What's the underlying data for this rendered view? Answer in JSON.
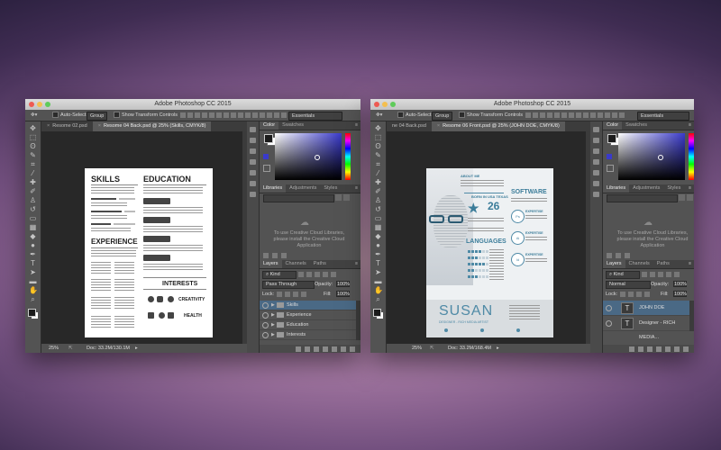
{
  "left": {
    "title": "Adobe Photoshop CC 2015",
    "options": {
      "auto_select": "Auto-Select:",
      "group": "Group",
      "transform": "Show Transform Controls",
      "workspace": "Essentials"
    },
    "tabs": [
      {
        "label": "Resome 02.psd",
        "active": false
      },
      {
        "label": "Resome 04 Back.psd @ 25% (Skills, CMYK/8)",
        "active": true
      }
    ],
    "status": {
      "zoom": "25%",
      "doc": "Doc: 33.2M/130.1M"
    },
    "resume": {
      "skills": "SKILLS",
      "education": "EDUCATION",
      "experience": "EXPERIENCE",
      "interests": "INTERESTS",
      "creativity": "CREATIVITY",
      "health": "HEALTH"
    },
    "color_tabs": [
      "Color",
      "Swatches"
    ],
    "libraries_tabs": [
      "Libraries",
      "Adjustments",
      "Styles"
    ],
    "libraries_msg": "To use Creative Cloud Libraries, please install the Creative Cloud Application",
    "layers_tabs": [
      "Layers",
      "Channels",
      "Paths"
    ],
    "kind": "Kind",
    "blend": "Pass Through",
    "opacity_label": "Opacity:",
    "opacity": "100%",
    "lock_label": "Lock:",
    "fill_label": "Fill:",
    "fill": "100%",
    "layers": [
      {
        "name": "Skills",
        "selected": true
      },
      {
        "name": "Experience",
        "selected": false
      },
      {
        "name": "Education",
        "selected": false
      },
      {
        "name": "Interests",
        "selected": false
      }
    ]
  },
  "right": {
    "title": "Adobe Photoshop CC 2015",
    "options": {
      "auto_select": "Auto-Select:",
      "group": "Group",
      "transform": "Show Transform Controls",
      "workspace": "Essentials"
    },
    "tabs": [
      {
        "label": "ne 04 Back.psd",
        "active": false
      },
      {
        "label": "Resome 06 Front.psd @ 25% (JOHN DOE, CMYK/8)",
        "active": true
      }
    ],
    "status": {
      "zoom": "25%",
      "doc": "Doc: 33.2M/168.4M"
    },
    "resume": {
      "about": "ABOUT ME",
      "born": "BORN IN USA TEXAS",
      "age": "26",
      "software": "SOFTWARE",
      "languages": "LANGUAGES",
      "name": "SUSAN",
      "subtitle": "DESIGNER - RICH MEDIA ARTIST",
      "skill_labels": [
        "EXPERTISE",
        "EXPERTISE",
        "EXPERTISE"
      ],
      "soft_icons": [
        "Ps",
        "Ai",
        "Id"
      ]
    },
    "color_tabs": [
      "Color",
      "Swatches"
    ],
    "libraries_tabs": [
      "Libraries",
      "Adjustments",
      "Styles"
    ],
    "libraries_msg": "To use Creative Cloud Libraries, please install the Creative Cloud Application",
    "layers_tabs": [
      "Layers",
      "Channels",
      "Paths"
    ],
    "kind": "Kind",
    "blend": "Normal",
    "opacity_label": "Opacity:",
    "opacity": "100%",
    "lock_label": "Lock:",
    "fill_label": "Fill:",
    "fill": "100%",
    "layers": [
      {
        "name": "JOHN DOE",
        "selected": true
      },
      {
        "name": "Designer - RICH MEDIA...",
        "selected": false
      }
    ]
  }
}
